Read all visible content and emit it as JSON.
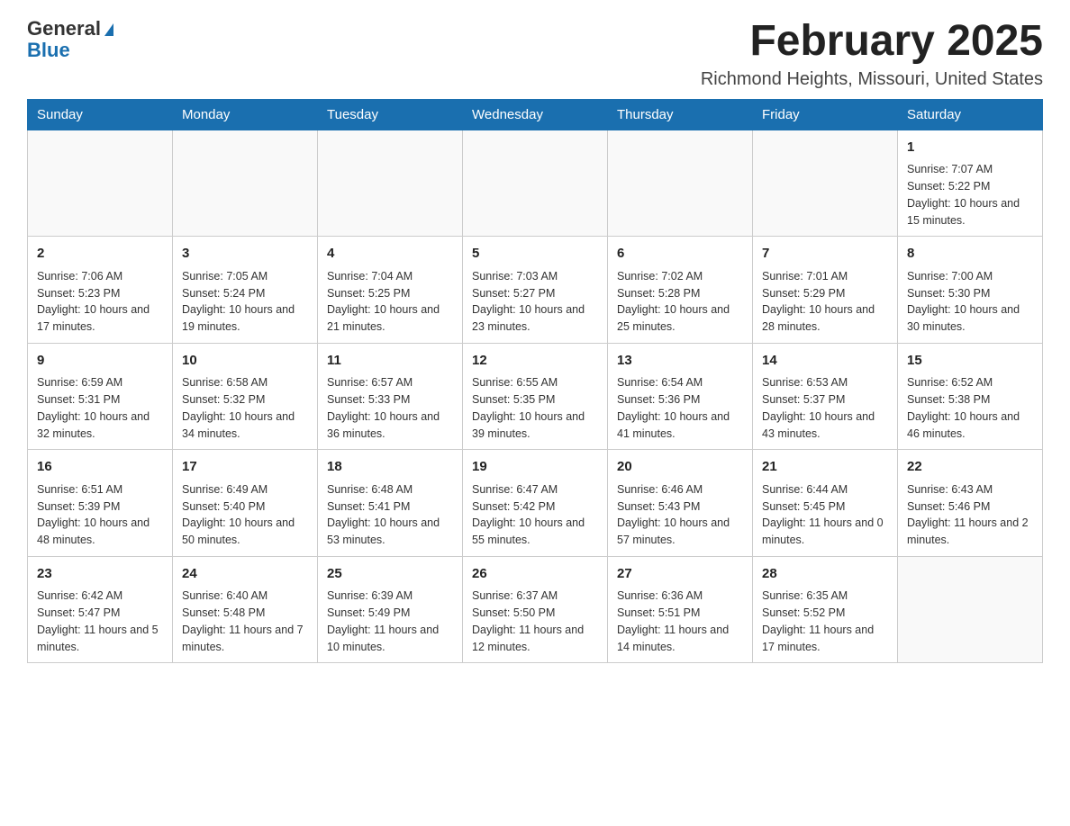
{
  "logo": {
    "general": "General",
    "blue": "Blue"
  },
  "title": "February 2025",
  "location": "Richmond Heights, Missouri, United States",
  "days_of_week": [
    "Sunday",
    "Monday",
    "Tuesday",
    "Wednesday",
    "Thursday",
    "Friday",
    "Saturday"
  ],
  "weeks": [
    [
      {
        "day": "",
        "info": ""
      },
      {
        "day": "",
        "info": ""
      },
      {
        "day": "",
        "info": ""
      },
      {
        "day": "",
        "info": ""
      },
      {
        "day": "",
        "info": ""
      },
      {
        "day": "",
        "info": ""
      },
      {
        "day": "1",
        "info": "Sunrise: 7:07 AM\nSunset: 5:22 PM\nDaylight: 10 hours and 15 minutes."
      }
    ],
    [
      {
        "day": "2",
        "info": "Sunrise: 7:06 AM\nSunset: 5:23 PM\nDaylight: 10 hours and 17 minutes."
      },
      {
        "day": "3",
        "info": "Sunrise: 7:05 AM\nSunset: 5:24 PM\nDaylight: 10 hours and 19 minutes."
      },
      {
        "day": "4",
        "info": "Sunrise: 7:04 AM\nSunset: 5:25 PM\nDaylight: 10 hours and 21 minutes."
      },
      {
        "day": "5",
        "info": "Sunrise: 7:03 AM\nSunset: 5:27 PM\nDaylight: 10 hours and 23 minutes."
      },
      {
        "day": "6",
        "info": "Sunrise: 7:02 AM\nSunset: 5:28 PM\nDaylight: 10 hours and 25 minutes."
      },
      {
        "day": "7",
        "info": "Sunrise: 7:01 AM\nSunset: 5:29 PM\nDaylight: 10 hours and 28 minutes."
      },
      {
        "day": "8",
        "info": "Sunrise: 7:00 AM\nSunset: 5:30 PM\nDaylight: 10 hours and 30 minutes."
      }
    ],
    [
      {
        "day": "9",
        "info": "Sunrise: 6:59 AM\nSunset: 5:31 PM\nDaylight: 10 hours and 32 minutes."
      },
      {
        "day": "10",
        "info": "Sunrise: 6:58 AM\nSunset: 5:32 PM\nDaylight: 10 hours and 34 minutes."
      },
      {
        "day": "11",
        "info": "Sunrise: 6:57 AM\nSunset: 5:33 PM\nDaylight: 10 hours and 36 minutes."
      },
      {
        "day": "12",
        "info": "Sunrise: 6:55 AM\nSunset: 5:35 PM\nDaylight: 10 hours and 39 minutes."
      },
      {
        "day": "13",
        "info": "Sunrise: 6:54 AM\nSunset: 5:36 PM\nDaylight: 10 hours and 41 minutes."
      },
      {
        "day": "14",
        "info": "Sunrise: 6:53 AM\nSunset: 5:37 PM\nDaylight: 10 hours and 43 minutes."
      },
      {
        "day": "15",
        "info": "Sunrise: 6:52 AM\nSunset: 5:38 PM\nDaylight: 10 hours and 46 minutes."
      }
    ],
    [
      {
        "day": "16",
        "info": "Sunrise: 6:51 AM\nSunset: 5:39 PM\nDaylight: 10 hours and 48 minutes."
      },
      {
        "day": "17",
        "info": "Sunrise: 6:49 AM\nSunset: 5:40 PM\nDaylight: 10 hours and 50 minutes."
      },
      {
        "day": "18",
        "info": "Sunrise: 6:48 AM\nSunset: 5:41 PM\nDaylight: 10 hours and 53 minutes."
      },
      {
        "day": "19",
        "info": "Sunrise: 6:47 AM\nSunset: 5:42 PM\nDaylight: 10 hours and 55 minutes."
      },
      {
        "day": "20",
        "info": "Sunrise: 6:46 AM\nSunset: 5:43 PM\nDaylight: 10 hours and 57 minutes."
      },
      {
        "day": "21",
        "info": "Sunrise: 6:44 AM\nSunset: 5:45 PM\nDaylight: 11 hours and 0 minutes."
      },
      {
        "day": "22",
        "info": "Sunrise: 6:43 AM\nSunset: 5:46 PM\nDaylight: 11 hours and 2 minutes."
      }
    ],
    [
      {
        "day": "23",
        "info": "Sunrise: 6:42 AM\nSunset: 5:47 PM\nDaylight: 11 hours and 5 minutes."
      },
      {
        "day": "24",
        "info": "Sunrise: 6:40 AM\nSunset: 5:48 PM\nDaylight: 11 hours and 7 minutes."
      },
      {
        "day": "25",
        "info": "Sunrise: 6:39 AM\nSunset: 5:49 PM\nDaylight: 11 hours and 10 minutes."
      },
      {
        "day": "26",
        "info": "Sunrise: 6:37 AM\nSunset: 5:50 PM\nDaylight: 11 hours and 12 minutes."
      },
      {
        "day": "27",
        "info": "Sunrise: 6:36 AM\nSunset: 5:51 PM\nDaylight: 11 hours and 14 minutes."
      },
      {
        "day": "28",
        "info": "Sunrise: 6:35 AM\nSunset: 5:52 PM\nDaylight: 11 hours and 17 minutes."
      },
      {
        "day": "",
        "info": ""
      }
    ]
  ]
}
